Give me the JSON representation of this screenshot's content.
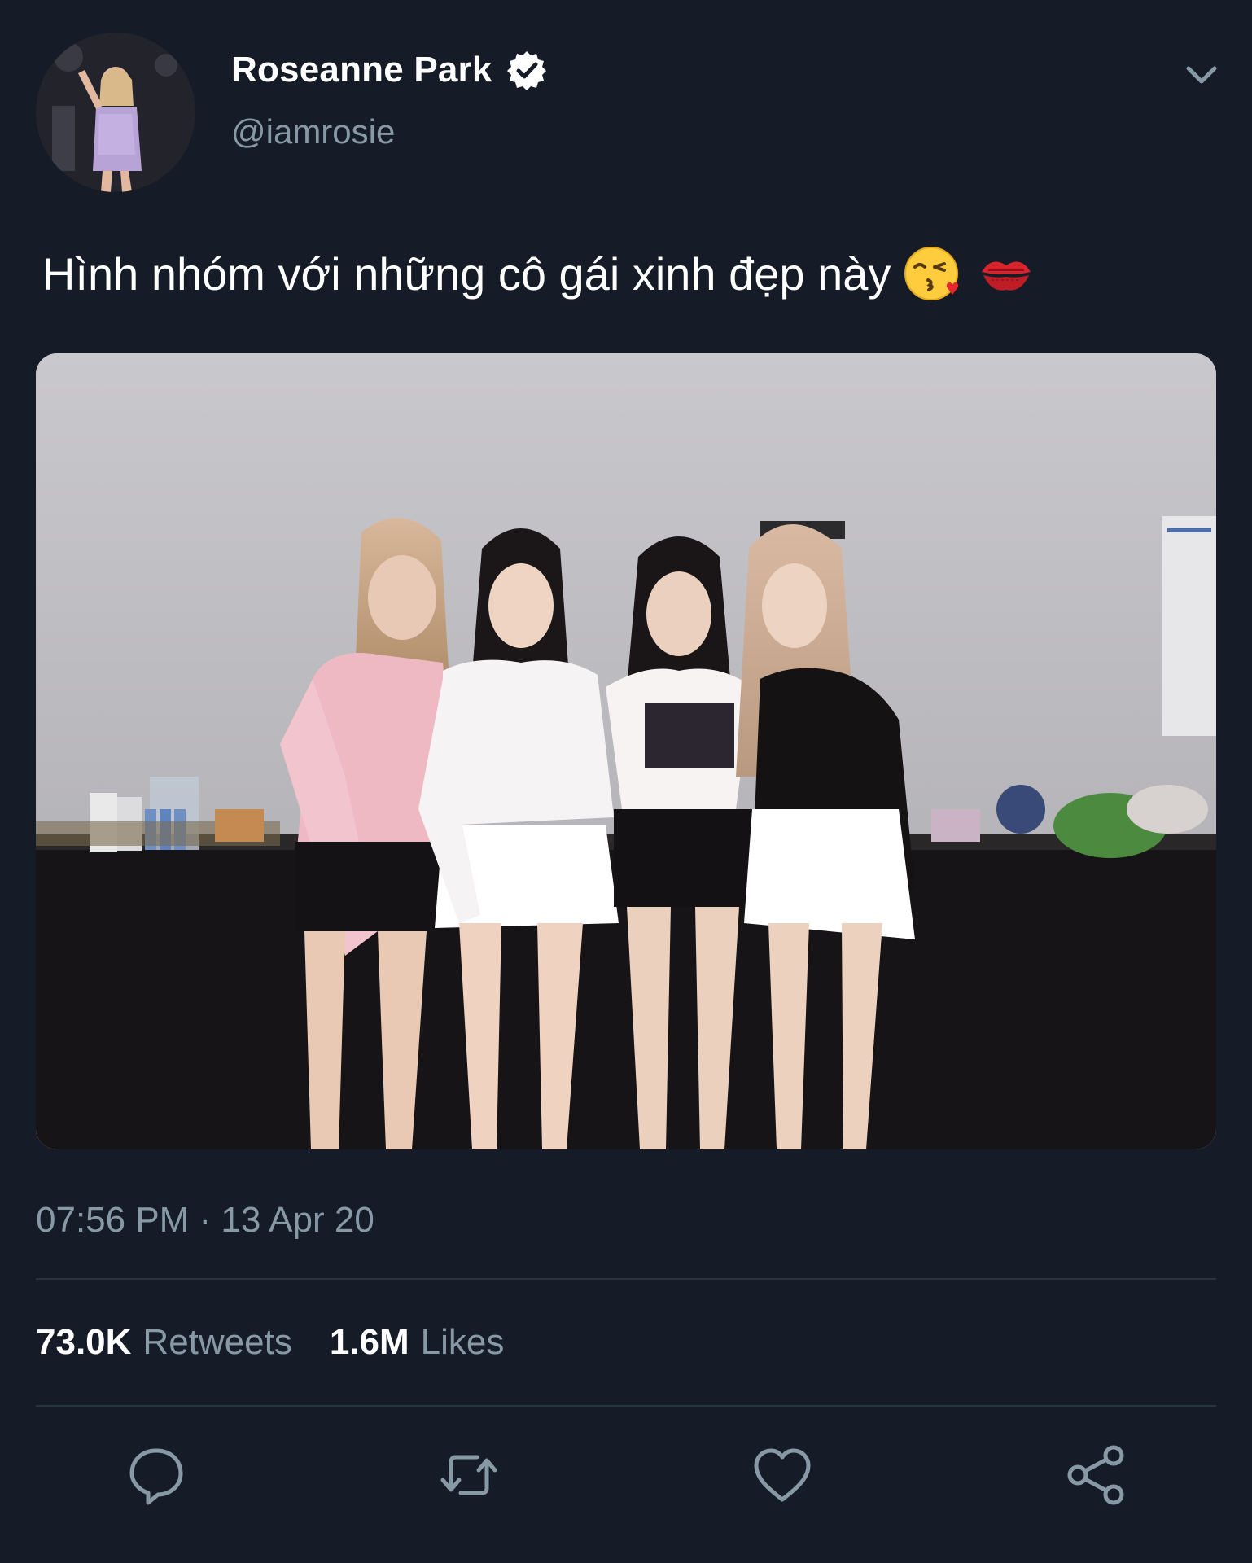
{
  "user": {
    "display_name": "Roseanne Park",
    "handle": "@iamrosie",
    "verified": true
  },
  "tweet": {
    "text": "Hình nhóm với những cô gái xinh đẹp này",
    "emojis": [
      "kissing-face-with-heart-emoji",
      "kiss-mark-emoji"
    ],
    "timestamp": "07:56 PM · 13 Apr 20"
  },
  "stats": {
    "retweets_count": "73.0K",
    "retweets_label": "Retweets",
    "likes_count": "1.6M",
    "likes_label": "Likes"
  },
  "icons": {
    "reply": "reply-icon",
    "retweet": "retweet-icon",
    "like": "like-icon",
    "share": "share-icon",
    "more": "chevron-down-icon"
  },
  "colors": {
    "background": "#151c27",
    "secondary_text": "#8899a6",
    "divider": "#2a3441"
  }
}
